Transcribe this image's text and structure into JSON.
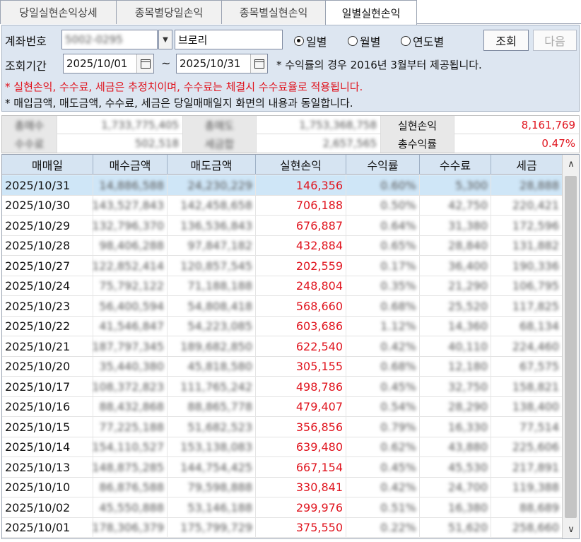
{
  "tabs": [
    {
      "label": "당일실현손익상세",
      "active": false
    },
    {
      "label": "종목별당일손익",
      "active": false
    },
    {
      "label": "종목별실현손익",
      "active": false
    },
    {
      "label": "일별실현손익",
      "active": true
    }
  ],
  "query": {
    "account_label": "계좌번호",
    "account_value": "5002-0295",
    "account_name": "브로리",
    "period_label": "조회기간",
    "date_from": "2025/10/01",
    "date_to": "2025/10/31",
    "date_sep": "~",
    "period_note": "* 수익률의 경우 2016년 3월부터 제공됩니다.",
    "radios": [
      {
        "label": "일별",
        "checked": true
      },
      {
        "label": "월별",
        "checked": false
      },
      {
        "label": "연도별",
        "checked": false
      }
    ],
    "search_button": "조회",
    "next_button": "다음",
    "note_red": "* 실현손익, 수수료, 세금은 추정치이며, 수수료는 체결시 수수료율로 적용됩니다.",
    "note_black": "* 매입금액, 매도금액, 수수료, 세금은 당일매매일지 화면의 내용과 동일합니다."
  },
  "summary": {
    "row1": [
      {
        "label": "총매수",
        "value": "1,733,775,405",
        "blurred": true
      },
      {
        "label": "총매도",
        "value": "1,753,368,758",
        "blurred": true
      },
      {
        "label": "실현손익",
        "value": "8,161,769",
        "blurred": false
      }
    ],
    "row2": [
      {
        "label": "수수료",
        "value": "502,518",
        "blurred": true
      },
      {
        "label": "세금합",
        "value": "2,657,565",
        "blurred": true
      },
      {
        "label": "총수익률",
        "value": "0.47%",
        "blurred": false
      }
    ]
  },
  "table": {
    "headers": [
      "매매일",
      "매수금액",
      "매도금액",
      "실현손익",
      "수익률",
      "수수료",
      "세금"
    ],
    "rows": [
      [
        "2025/10/31",
        "14,886,588",
        "24,230,229",
        "146,356",
        "0.60%",
        "5,300",
        "28,888"
      ],
      [
        "2025/10/30",
        "143,527,843",
        "142,458,658",
        "706,188",
        "0.50%",
        "42,750",
        "220,421"
      ],
      [
        "2025/10/29",
        "132,796,370",
        "136,536,843",
        "676,887",
        "0.64%",
        "31,380",
        "172,596"
      ],
      [
        "2025/10/28",
        "98,406,288",
        "97,847,182",
        "432,884",
        "0.65%",
        "28,840",
        "131,882"
      ],
      [
        "2025/10/27",
        "122,852,414",
        "120,857,545",
        "202,559",
        "0.17%",
        "36,400",
        "190,336"
      ],
      [
        "2025/10/24",
        "75,792,122",
        "71,188,188",
        "248,804",
        "0.35%",
        "21,290",
        "106,795"
      ],
      [
        "2025/10/23",
        "56,400,594",
        "54,808,418",
        "568,660",
        "0.68%",
        "25,520",
        "117,825"
      ],
      [
        "2025/10/22",
        "41,546,847",
        "54,223,085",
        "603,686",
        "1.12%",
        "14,360",
        "68,134"
      ],
      [
        "2025/10/21",
        "187,797,345",
        "189,682,850",
        "622,540",
        "0.42%",
        "40,110",
        "224,460"
      ],
      [
        "2025/10/20",
        "35,440,380",
        "45,818,580",
        "305,155",
        "0.68%",
        "12,180",
        "67,575"
      ],
      [
        "2025/10/17",
        "108,372,823",
        "111,765,242",
        "498,786",
        "0.45%",
        "32,750",
        "158,821"
      ],
      [
        "2025/10/16",
        "88,432,868",
        "88,865,778",
        "479,407",
        "0.54%",
        "28,290",
        "138,400"
      ],
      [
        "2025/10/15",
        "77,225,188",
        "51,682,523",
        "356,856",
        "0.79%",
        "16,330",
        "77,514"
      ],
      [
        "2025/10/14",
        "154,110,527",
        "153,138,083",
        "639,480",
        "0.62%",
        "43,880",
        "225,606"
      ],
      [
        "2025/10/13",
        "148,875,285",
        "144,754,425",
        "667,154",
        "0.45%",
        "45,530",
        "217,891"
      ],
      [
        "2025/10/10",
        "86,876,588",
        "79,598,888",
        "330,841",
        "0.42%",
        "24,700",
        "119,388"
      ],
      [
        "2025/10/02",
        "45,550,888",
        "53,146,188",
        "299,976",
        "0.51%",
        "16,380",
        "88,689"
      ],
      [
        "2025/10/01",
        "178,306,379",
        "175,799,729",
        "375,550",
        "0.22%",
        "51,620",
        "258,660"
      ]
    ]
  }
}
